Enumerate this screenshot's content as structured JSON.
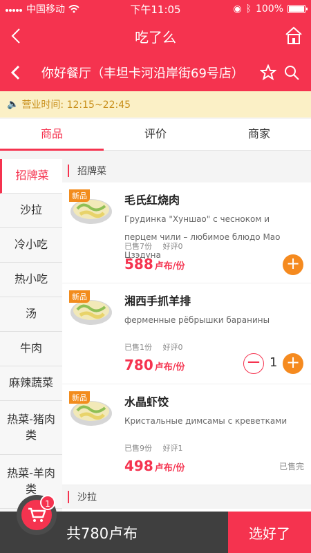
{
  "status": {
    "carrier": "中国移动",
    "time": "下午11:05",
    "battery": "100%"
  },
  "app": {
    "title": "吃了么"
  },
  "shop": {
    "name": "你好餐厅（丰坦卡河沿岸街69号店）"
  },
  "notice": {
    "hours": "营业时间: 12:15~22:45"
  },
  "tabs": [
    "商品",
    "评价",
    "商家"
  ],
  "menu": [
    "招牌菜",
    "沙拉",
    "冷小吃",
    "热小吃",
    "汤",
    "牛肉",
    "麻辣蔬菜",
    "热菜-猪肉类",
    "热菜-羊肉类"
  ],
  "section": {
    "title": "招牌菜",
    "next_title": "沙拉"
  },
  "dishes": [
    {
      "badge": "新品",
      "name": "毛氏红烧肉",
      "desc": "Грудинка \"Хуншао\" с чесноком и перцем чили – любимое блюдо Мао Цзэдуна",
      "sold": "已售7份",
      "rating": "好评0",
      "price": "588",
      "unit": "卢布/份",
      "plus": "+"
    },
    {
      "badge": "新品",
      "name": "湘西手抓羊排",
      "desc": "ферменные рёбрышки баранины",
      "sold": "已售1份",
      "rating": "好评0",
      "price": "780",
      "unit": "卢布/份",
      "minus": "−",
      "qty": "1",
      "plus": "+"
    },
    {
      "badge": "新品",
      "name": "水晶虾饺",
      "desc": "Кристальные димсамы с креветками",
      "sold": "已售9份",
      "rating": "好评1",
      "price": "498",
      "unit": "卢布/份",
      "soldout": "已售完"
    }
  ],
  "cart": {
    "badge": "1",
    "total": "共780卢布",
    "confirm": "选好了"
  }
}
